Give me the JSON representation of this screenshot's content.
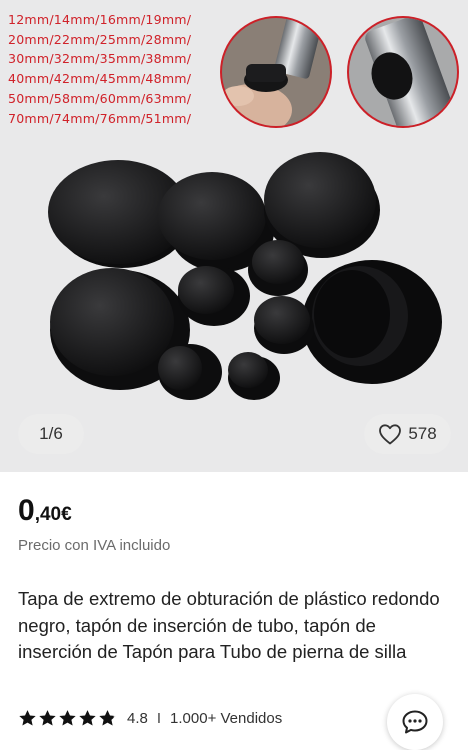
{
  "gallery": {
    "size_lines": [
      "12mm/14mm/16mm/19mm/",
      "20mm/22mm/25mm/28mm/",
      "30mm/32mm/35mm/38mm/",
      "40mm/42mm/45mm/48mm/",
      "50mm/58mm/60mm/63mm/",
      "70mm/74mm/76mm/51mm/"
    ],
    "image_counter": "1/6",
    "likes": "578",
    "heart_icon": "heart-outline-icon",
    "colors": {
      "size_text": "#d0222a",
      "background": "#e9e9ea"
    }
  },
  "product": {
    "price_integer": "0",
    "price_decimal": ",40€",
    "tax_note": "Precio con IVA incluido",
    "title": "Tapa de extremo de obturación de plástico redondo negro, tapón de inserción de tubo, tapón de inserción de Tapón para Tubo de pierna de silla",
    "rating_value": "4.8",
    "rating_stars": 4.8,
    "separator": "I",
    "sold": "1.000+ Vendidos",
    "chat_icon": "chat-bubble-icon"
  }
}
